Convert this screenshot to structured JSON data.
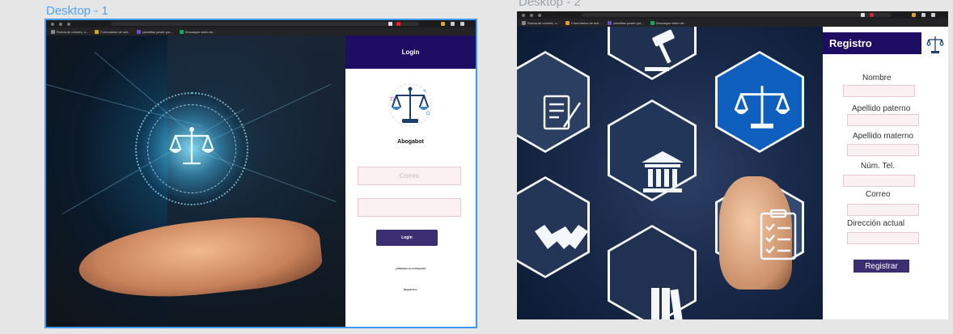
{
  "frames": [
    {
      "title": "Desktop - 1",
      "bookmarks": [
        "Rueda de colores, u...",
        "Formularios de soli...",
        "plantillas power poi...",
        "Descargar video de..."
      ],
      "login": {
        "header": "Login",
        "brand": "Abogabot",
        "email_placeholder": "Correo",
        "password_placeholder": "",
        "button": "Login",
        "forgot_link": "¿Olvidaste tu contraseña?",
        "register_link": "Registrarse"
      }
    },
    {
      "title": "Desktop - 2",
      "bookmarks": [
        "Rueda de colores, u...",
        "Formularios de soli...",
        "plantillas power poi...",
        "Descargar video de..."
      ],
      "registro": {
        "header": "Registro",
        "fields": [
          "Nombre",
          "Apellido paterno",
          "Apellido materno",
          "Núm. Tel.",
          "Correo",
          "Dirección actual"
        ],
        "button": "Registrar"
      }
    }
  ],
  "colors": {
    "frame_selection": "#3d99f0",
    "header_purple": "#1d0d63",
    "button_purple": "#3b2f72",
    "input_bg": "#fbf1f2",
    "input_border": "#e9c9cf"
  },
  "icons": [
    "scales-of-justice-icon",
    "gavel-icon",
    "courthouse-icon",
    "handshake-icon",
    "checklist-icon",
    "document-icon",
    "books-icon"
  ]
}
